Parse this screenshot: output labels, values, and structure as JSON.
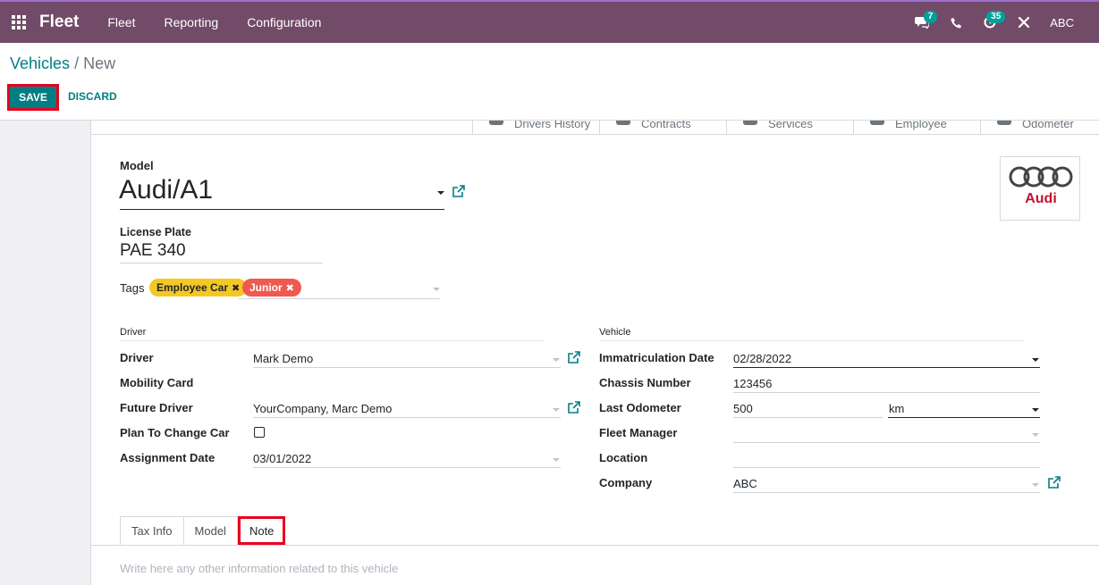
{
  "nav": {
    "app_name": "Fleet",
    "menu": [
      "Fleet",
      "Reporting",
      "Configuration"
    ],
    "messages_count": "7",
    "activities_count": "35",
    "user": "ABC"
  },
  "breadcrumb": {
    "parent": "Vehicles",
    "separator": "/",
    "current": "New"
  },
  "actions": {
    "save": "SAVE",
    "discard": "DISCARD"
  },
  "smart_buttons": [
    "Drivers History",
    "Contracts",
    "Services",
    "Employee",
    "Odometer"
  ],
  "form": {
    "model_label": "Model",
    "model_value": "Audi/A1",
    "license_plate_label": "License Plate",
    "license_plate_value": "PAE 340",
    "tags_label": "Tags",
    "tags": [
      {
        "label": "Employee Car",
        "color": "#f4c824"
      },
      {
        "label": "Junior",
        "color": "#ef5a4f"
      }
    ],
    "driver_section": "Driver",
    "vehicle_section": "Vehicle",
    "driver_fields": {
      "driver_label": "Driver",
      "driver_value": "Mark Demo",
      "mobility_card_label": "Mobility Card",
      "future_driver_label": "Future Driver",
      "future_driver_value": "YourCompany, Marc Demo",
      "plan_to_change_label": "Plan To Change Car",
      "assignment_date_label": "Assignment Date",
      "assignment_date_value": "03/01/2022"
    },
    "vehicle_fields": {
      "immatriculation_label": "Immatriculation Date",
      "immatriculation_value": "02/28/2022",
      "chassis_label": "Chassis Number",
      "chassis_value": "123456",
      "odometer_label": "Last Odometer",
      "odometer_value": "500",
      "odometer_unit": "km",
      "fleet_manager_label": "Fleet Manager",
      "location_label": "Location",
      "company_label": "Company",
      "company_value": "ABC"
    },
    "logo_text": "Audi"
  },
  "tabs": [
    "Tax Info",
    "Model",
    "Note"
  ],
  "active_tab": "Note",
  "note_placeholder": "Write here any other information related to this vehicle",
  "colors": {
    "navbar": "#714b67",
    "primary": "#017e84",
    "highlight": "#e8001c"
  }
}
